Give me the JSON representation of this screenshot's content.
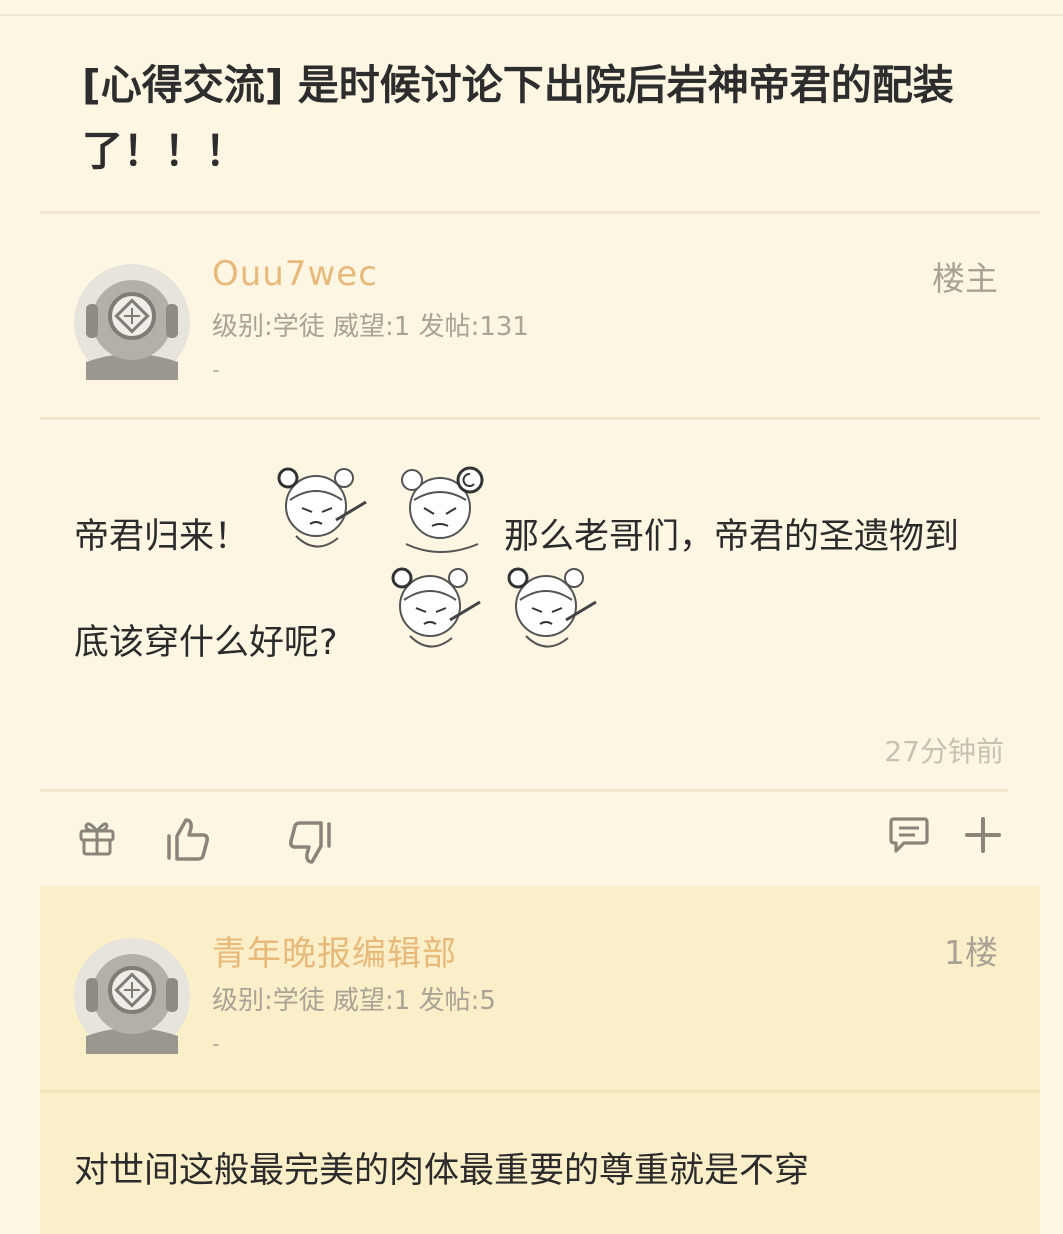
{
  "thread": {
    "title": "[心得交流] 是时候讨论下出院后岩神帝君的配装了！！！"
  },
  "posts": [
    {
      "username": "Ouu7wec",
      "meta": "级别:学徒  威望:1  发帖:131",
      "dash": "-",
      "floor": "楼主",
      "text_line1_a": "帝君归来！",
      "text_line1_b": "那么老哥们，帝君的圣遗物到",
      "text_line2": "底该穿什么好呢?",
      "time": "27分钟前"
    },
    {
      "username": "青年晚报编辑部",
      "meta": "级别:学徒  威望:1  发帖:5",
      "dash": "-",
      "floor": "1楼",
      "text": "对世间这般最完美的肉体最重要的尊重就是不穿"
    }
  ],
  "actions": {
    "gift_icon": "gift-icon",
    "like_icon": "thumbs-up-icon",
    "dislike_icon": "thumbs-down-icon",
    "comment_icon": "comment-icon",
    "more_icon": "plus-icon"
  },
  "colors": {
    "background": "#fcf6e3",
    "reply_background": "#fbefc9",
    "username": "#e7b97a",
    "meta": "#a9a396"
  }
}
